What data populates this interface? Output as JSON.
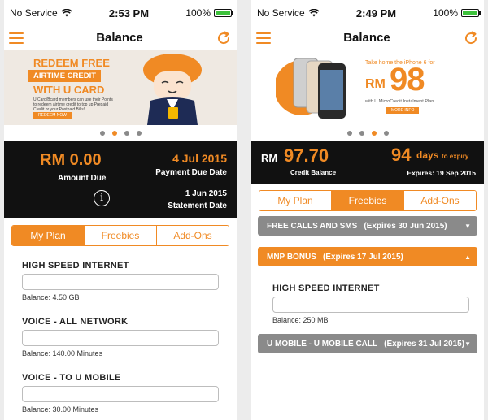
{
  "left": {
    "status": {
      "carrier": "No Service",
      "time": "2:53 PM",
      "battery": "100%"
    },
    "nav": {
      "title": "Balance"
    },
    "banner": {
      "headline_1": "REDEEM FREE",
      "headline_2": "AIRTIME CREDIT",
      "headline_3": "WITH U CARD",
      "body": "U Card/Bcard members can use their Points to redeem airtime credit to top up Prepaid Credit or your Postpaid Bills!",
      "cta": "REDEEM NOW"
    },
    "carousel": {
      "count": 4,
      "active": 1
    },
    "summary": {
      "amount": "RM 0.00",
      "amount_label": "Amount Due",
      "due_date": "4 Jul 2015",
      "due_label": "Payment Due Date",
      "statement_date": "1 Jun 2015",
      "statement_label": "Statement Date",
      "info": "i"
    },
    "tabs": [
      {
        "label": "My Plan",
        "active": true
      },
      {
        "label": "Freebies",
        "active": false
      },
      {
        "label": "Add-Ons",
        "active": false
      }
    ],
    "usage": [
      {
        "title": "HIGH SPEED INTERNET",
        "balance": "Balance: 4.50 GB"
      },
      {
        "title": "VOICE - ALL NETWORK",
        "balance": "Balance: 140.00 Minutes"
      },
      {
        "title": "VOICE - TO U MOBILE",
        "balance": "Balance: 30.00 Minutes"
      }
    ]
  },
  "right": {
    "status": {
      "carrier": "No Service",
      "time": "2:49 PM",
      "battery": "100%"
    },
    "nav": {
      "title": "Balance"
    },
    "banner": {
      "tagline": "Take home the iPhone 6 for",
      "currency": "RM",
      "price": "98",
      "plan": "with U MicroCredit Instalment Plan",
      "cta": "MORE INFO"
    },
    "carousel": {
      "count": 4,
      "active": 2
    },
    "summary": {
      "currency": "RM",
      "amount": "97.70",
      "amount_label": "Credit Balance",
      "days": "94",
      "days_suffix": "days",
      "days_label": "to expiry",
      "expires": "Expires: 19 Sep 2015"
    },
    "tabs": [
      {
        "label": "My Plan",
        "active": false
      },
      {
        "label": "Freebies",
        "active": true
      },
      {
        "label": "Add-Ons",
        "active": false
      }
    ],
    "sections": [
      {
        "title": "FREE CALLS AND SMS",
        "expiry": "(Expires 30 Jun 2015)",
        "caret": "▼"
      },
      {
        "title": "MNP BONUS",
        "expiry": "(Expires 17 Jul 2015)",
        "caret": "▲"
      },
      {
        "title": "U MOBILE - U MOBILE CALL",
        "expiry": "(Expires 31 Jul 2015)",
        "caret": "▼"
      }
    ],
    "usage": [
      {
        "title": "HIGH SPEED INTERNET",
        "balance": "Balance: 250 MB"
      }
    ]
  },
  "colors": {
    "accent": "#f08a24",
    "dark": "#111111",
    "grey": "#8a8a8a",
    "battery": "#3cc13b"
  }
}
